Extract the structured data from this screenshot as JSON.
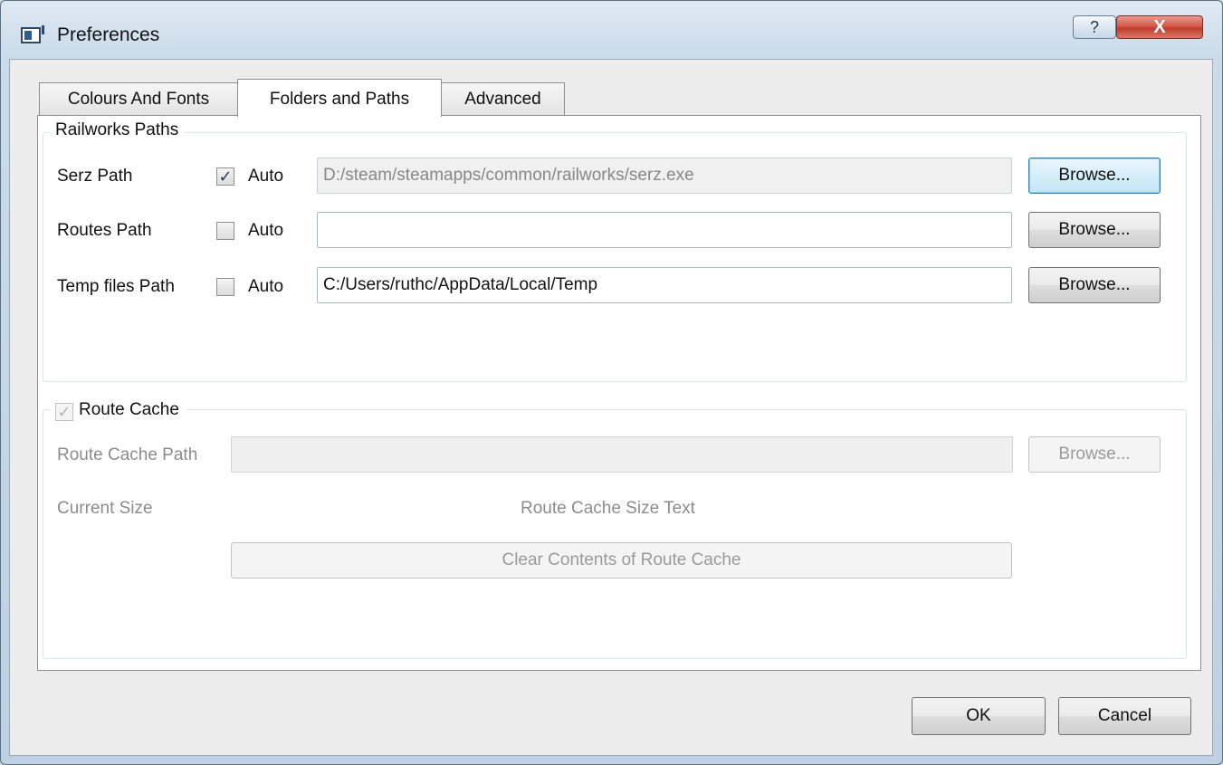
{
  "window": {
    "title": "Preferences",
    "help_label": "?",
    "close_label": "X"
  },
  "tabs": [
    {
      "label": "Colours And Fonts",
      "active": false
    },
    {
      "label": "Folders and Paths",
      "active": true
    },
    {
      "label": "Advanced",
      "active": false
    }
  ],
  "railworks": {
    "group_title": "Railworks Paths",
    "auto_label": "Auto",
    "browse_label": "Browse...",
    "rows": [
      {
        "label": "Serz Path",
        "auto_checked": true,
        "value": "D:/steam/steamapps/common/railworks/serz.exe",
        "readonly": true
      },
      {
        "label": "Routes Path",
        "auto_checked": false,
        "value": "",
        "readonly": false
      },
      {
        "label": "Temp files Path",
        "auto_checked": false,
        "value": "C:/Users/ruthc/AppData/Local/Temp",
        "readonly": false
      }
    ]
  },
  "route_cache": {
    "group_title": "Route Cache",
    "checked": true,
    "enabled": false,
    "path_label": "Route Cache Path",
    "path_value": "",
    "browse_label": "Browse...",
    "current_size_label": "Current Size",
    "size_text": "Route Cache Size Text",
    "clear_label": "Clear Contents of Route Cache"
  },
  "footer": {
    "ok_label": "OK",
    "cancel_label": "Cancel"
  }
}
